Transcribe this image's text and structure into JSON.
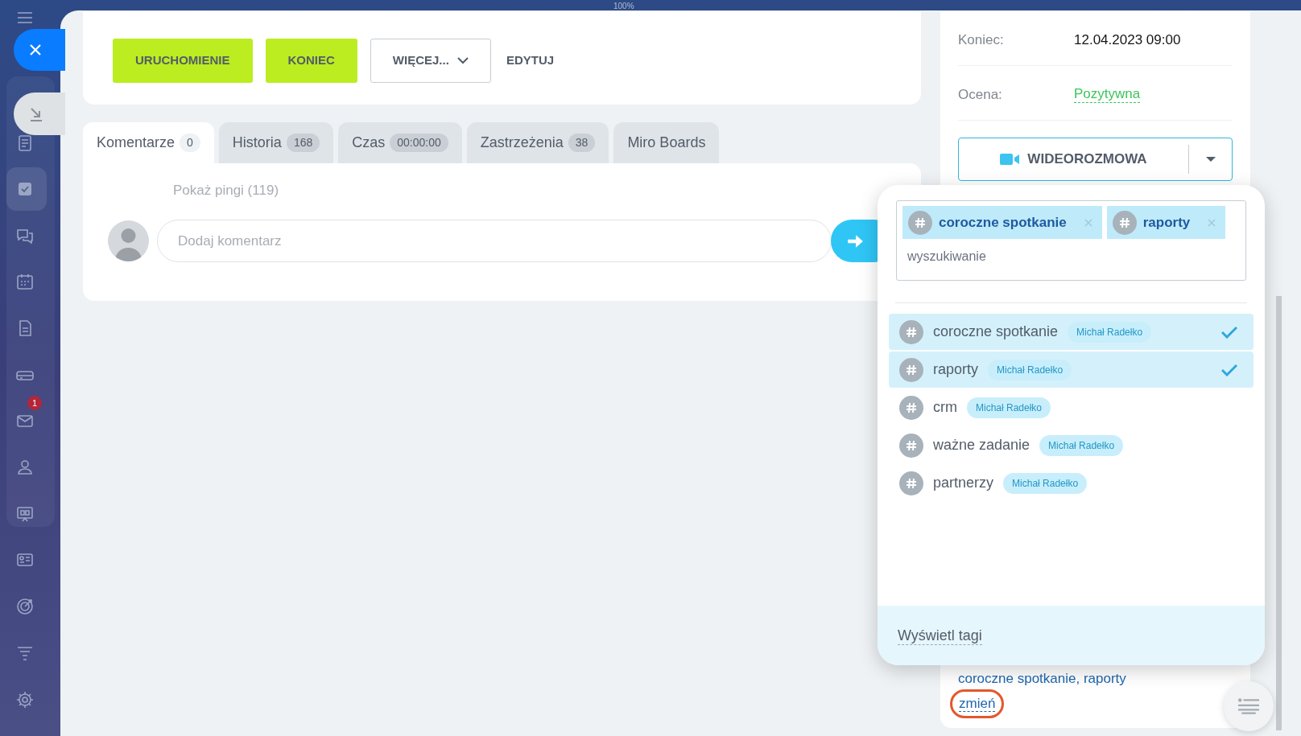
{
  "zoom_label": "100%",
  "sidebar": {
    "mail_badge": "1"
  },
  "toolbar": [
    {
      "label": "URUCHOMIENIE",
      "kind": "primary"
    },
    {
      "label": "KONIEC",
      "kind": "primary"
    },
    {
      "label": "WIĘCEJ...",
      "kind": "dropdown"
    },
    {
      "label": "EDYTUJ",
      "kind": "link"
    }
  ],
  "tabs": [
    {
      "label": "Komentarze",
      "count": "0",
      "selected": true
    },
    {
      "label": "Historia",
      "count": "168",
      "selected": false
    },
    {
      "label": "Czas",
      "count": "00:00:00",
      "selected": false
    },
    {
      "label": "Zastrzeżenia",
      "count": "38",
      "selected": false
    },
    {
      "label": "Miro Boards",
      "selected": false
    }
  ],
  "comments": {
    "pings_link": "Pokaż pingi (119)",
    "placeholder": "Dodaj komentarz"
  },
  "details": {
    "fields": [
      {
        "label": "Koniec:",
        "value": "12.04.2023 09:00",
        "kind": "plain"
      },
      {
        "label": "Ocena:",
        "value": "Pozytywna",
        "kind": "rating"
      }
    ],
    "video_button": "WIDEOROZMOWA",
    "tags_text": "coroczne spotkanie, raporty",
    "change_link": "zmień"
  },
  "tag_popup": {
    "chosen": [
      {
        "label": "coroczne spotkanie"
      },
      {
        "label": "raporty"
      }
    ],
    "search_placeholder": "wyszukiwanie",
    "options": [
      {
        "label": "coroczne spotkanie",
        "owner": "Michał Radełko",
        "selected": true
      },
      {
        "label": "raporty",
        "owner": "Michał Radełko",
        "selected": true
      },
      {
        "label": "crm",
        "owner": "Michał Radełko",
        "selected": false
      },
      {
        "label": "ważne zadanie",
        "owner": "Michał Radełko",
        "selected": false
      },
      {
        "label": "partnerzy",
        "owner": "Michał Radełko",
        "selected": false
      }
    ],
    "footer_link": "Wyświetl tagi"
  }
}
